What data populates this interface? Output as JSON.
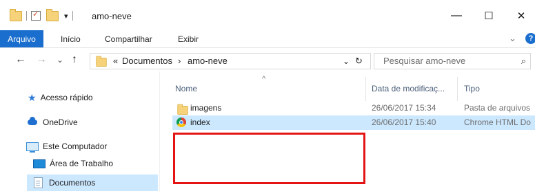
{
  "window": {
    "title": "amo-neve",
    "minimize": "—",
    "maximize": "☐",
    "close": "✕"
  },
  "quick_access": {
    "dropdown": "▾"
  },
  "ribbon": {
    "file_tab": "Arquivo",
    "tabs": [
      "Início",
      "Compartilhar",
      "Exibir"
    ],
    "expand": "⌄",
    "help": "?"
  },
  "nav": {
    "back": "←",
    "forward": "→",
    "recent": "⌄",
    "up": "↑",
    "breadcrumb_overflow": "«",
    "breadcrumb": [
      "Documentos",
      "amo-neve"
    ],
    "breadcrumb_sep": "›",
    "address_dropdown": "⌄",
    "refresh": "↻",
    "search_placeholder": "Pesquisar amo-neve",
    "search_icon": "⌕"
  },
  "sidebar": {
    "items": [
      {
        "label": "Acesso rápido",
        "icon": "star-icon"
      },
      {
        "label": "OneDrive",
        "icon": "cloud-icon"
      },
      {
        "label": "Este Computador",
        "icon": "computer-icon"
      },
      {
        "label": "Área de Trabalho",
        "icon": "desktop-icon"
      },
      {
        "label": "Documentos",
        "icon": "documents-icon"
      }
    ]
  },
  "columns": {
    "sort_arrow": "^",
    "name": "Nome",
    "date": "Data de modificaç...",
    "type": "Tipo"
  },
  "files": [
    {
      "name": "imagens",
      "date": "26/06/2017 15:34",
      "type": "Pasta de arquivos",
      "icon": "folder-icon"
    },
    {
      "name": "index",
      "date": "26/06/2017 15:40",
      "type": "Chrome HTML Do",
      "icon": "chrome-icon"
    }
  ],
  "colors": {
    "accent": "#1a6ecd",
    "selection": "#cce8ff",
    "highlight_box": "#e41414"
  }
}
